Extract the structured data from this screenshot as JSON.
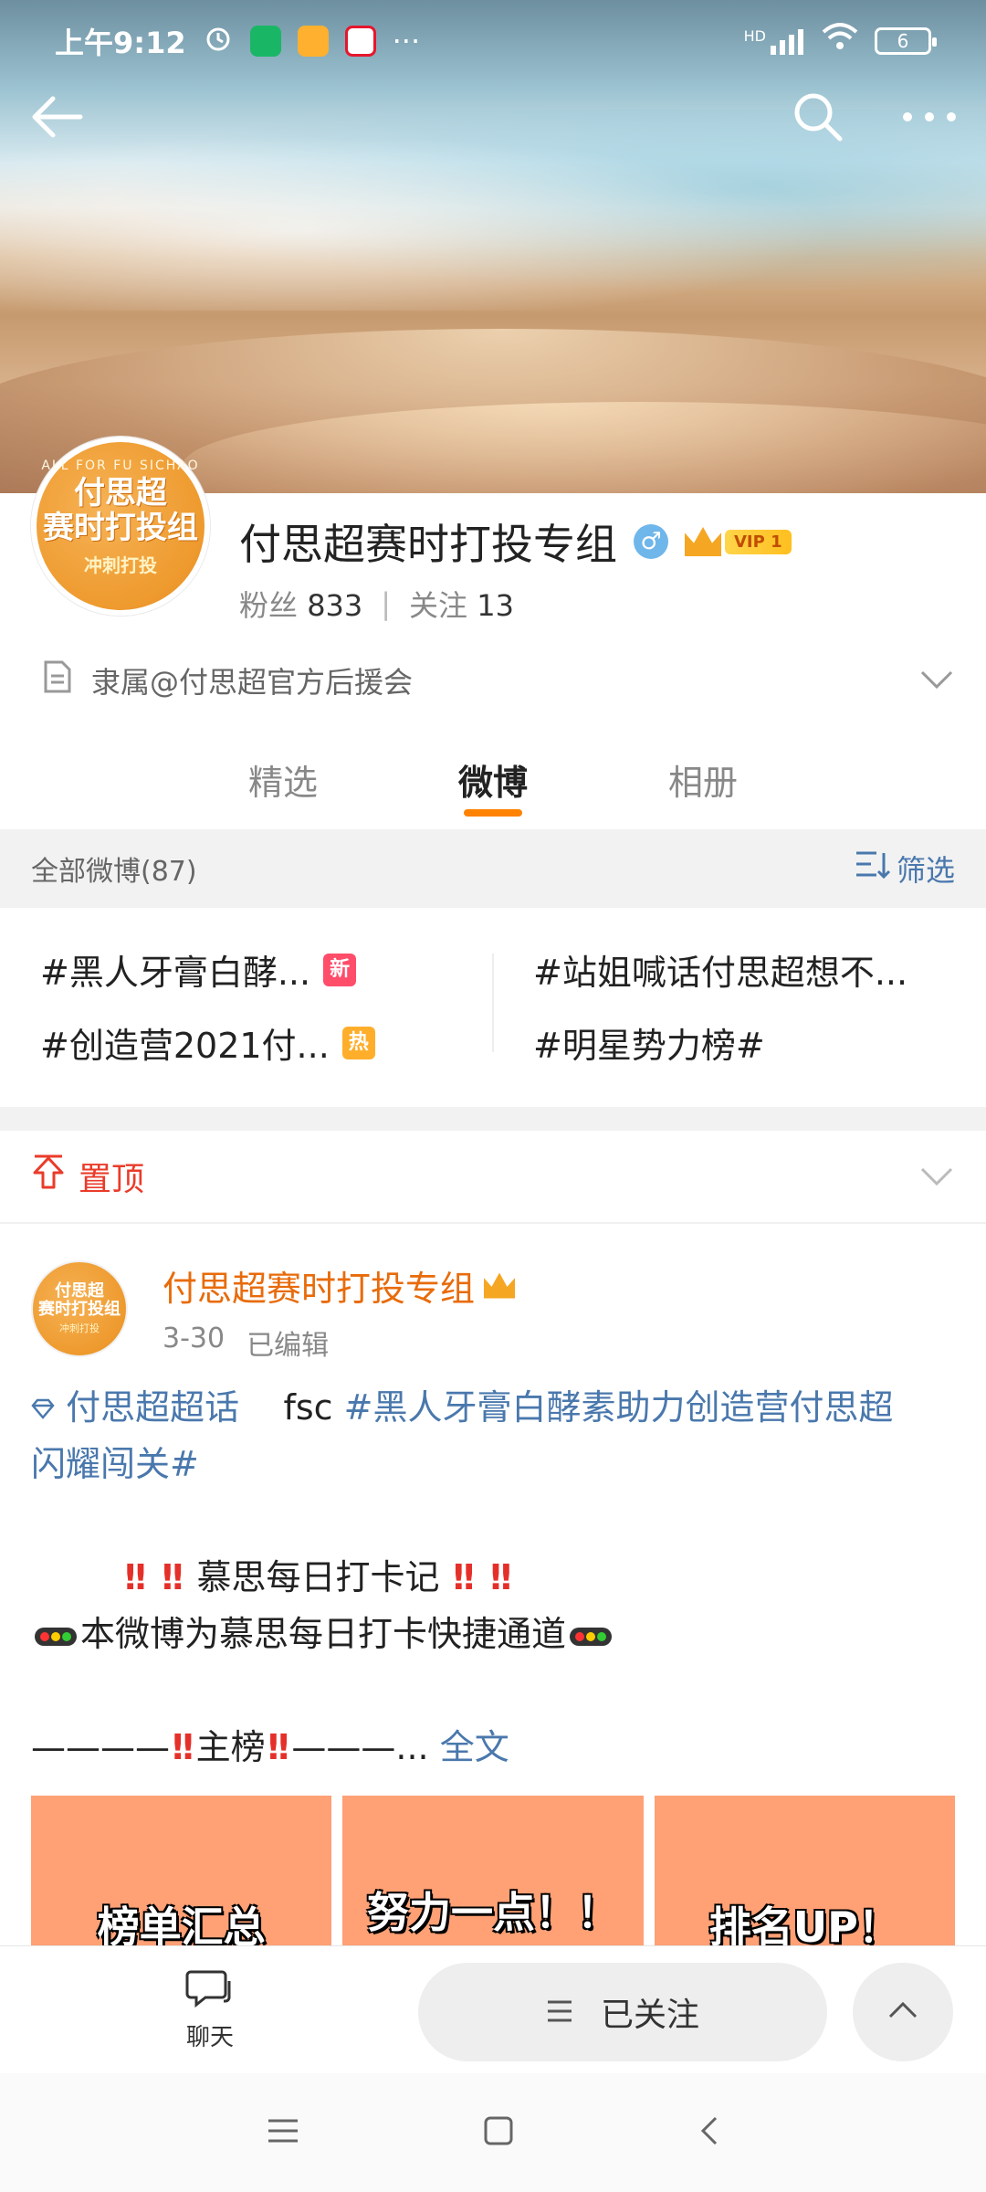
{
  "status_bar": {
    "time": "上午9:12",
    "more": "···",
    "battery": "6",
    "network": "HD"
  },
  "profile": {
    "name": "付思超赛时打投专组",
    "gender_symbol": "♂",
    "vip_label": "VIP 1",
    "fans_label": "粉丝",
    "fans_count": "833",
    "divider": "|",
    "following_label": "关注",
    "following_count": "13",
    "affiliation": "隶属@付思超官方后援会",
    "avatar_text_line1": "付思超",
    "avatar_text_line2": "赛时打投组",
    "avatar_text_sub": "冲刺打投",
    "avatar_arc": "ALL FOR FU SICHAO"
  },
  "tabs": [
    {
      "label": "精选",
      "active": false
    },
    {
      "label": "微博",
      "active": true
    },
    {
      "label": "相册",
      "active": false
    }
  ],
  "filter": {
    "all_label": "全部微博(87)",
    "filter_label": "筛选"
  },
  "topics": [
    {
      "text": "#黑人牙膏白酵...",
      "tag": "新"
    },
    {
      "text": "#站姐喊话付思超想不...",
      "tag": ""
    },
    {
      "text": "#创造营2021付...",
      "tag": "热"
    },
    {
      "text": "#明星势力榜#",
      "tag": ""
    }
  ],
  "pinned": {
    "label": "置顶"
  },
  "post": {
    "author": "付思超赛时打投专组",
    "date": "3-30",
    "edited": "已编辑",
    "supertopic": "付思超超话",
    "text_fsc": "fsc",
    "hashtag_part1": "#黑人牙膏白酵素助力创造营付思超",
    "hashtag_part2": "闪耀闯关#",
    "checkin_title": "慕思每日打卡记",
    "checkin_desc": "本微博为慕思每日打卡快捷通道",
    "main_list_prefix": "————",
    "main_list": "主榜",
    "main_list_suffix": "———...",
    "full_text": "全文",
    "images": [
      "榜单汇总",
      "努力一点！！",
      "排名UP！"
    ]
  },
  "action_bar": {
    "chat_label": "聊天",
    "follow_label": "已关注"
  },
  "colors": {
    "accent_orange": "#ff8200",
    "link_blue": "#4a78ad",
    "pinned_red": "#ea3b2a",
    "author_orange": "#e86b0a"
  }
}
